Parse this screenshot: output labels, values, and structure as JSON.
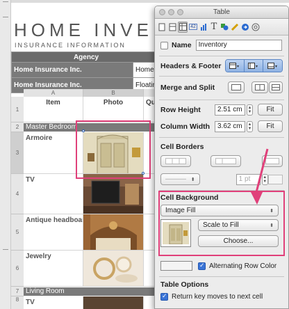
{
  "document": {
    "title": "HOME INVEN",
    "subtitle": "Insurance Information",
    "agency_table": {
      "header": "Agency",
      "rows": [
        {
          "company": "Home Insurance Inc.",
          "value": "Homeo"
        },
        {
          "company": "Home Insurance Inc.",
          "value": "Floatin"
        }
      ]
    },
    "sheet": {
      "columns": [
        "A",
        "B",
        "Qu"
      ],
      "headers": [
        "Item",
        "Photo",
        "Qu"
      ],
      "rows": [
        {
          "num": "1",
          "type": "header"
        },
        {
          "num": "2",
          "type": "section",
          "label": "Master Bedroom"
        },
        {
          "num": "3",
          "type": "item",
          "label": "Armoire"
        },
        {
          "num": "4",
          "type": "item",
          "label": "TV"
        },
        {
          "num": "5",
          "type": "item",
          "label": "Antique headboard"
        },
        {
          "num": "6",
          "type": "item",
          "label": "Jewelry"
        },
        {
          "num": "7",
          "type": "section",
          "label": "Living Room"
        },
        {
          "num": "8",
          "type": "item",
          "label": "TV"
        }
      ]
    }
  },
  "inspector": {
    "window_title": "Table",
    "toolbar_icons": [
      "document-icon",
      "layout-icon",
      "table-icon",
      "format-42-icon",
      "chart-icon",
      "text-icon",
      "graphic-icon",
      "metrics-icon",
      "link-icon",
      "color-wheel-icon"
    ],
    "name": {
      "label": "Name",
      "value": "Inventory",
      "checked": false
    },
    "headers_footer": {
      "label": "Headers & Footer"
    },
    "merge_split": {
      "label": "Merge and Split"
    },
    "row_height": {
      "label": "Row Height",
      "value": "2.51 cm",
      "fit": "Fit"
    },
    "column_width": {
      "label": "Column Width",
      "value": "3.62 cm",
      "fit": "Fit"
    },
    "cell_borders": {
      "label": "Cell Borders",
      "stroke": "1 pt"
    },
    "cell_background": {
      "label": "Cell Background",
      "fill_type": "Image Fill",
      "scale": "Scale to Fill",
      "choose": "Choose..."
    },
    "alternating_row_color": {
      "label": "Alternating Row Color",
      "checked": true
    },
    "table_options": {
      "label": "Table Options",
      "return_key": {
        "label": "Return key moves to next cell",
        "checked": true
      }
    }
  },
  "colors": {
    "accent_pink": "#e0407a",
    "section_gray": "#7a7a7a",
    "selection_blue": "#3a74d6"
  }
}
